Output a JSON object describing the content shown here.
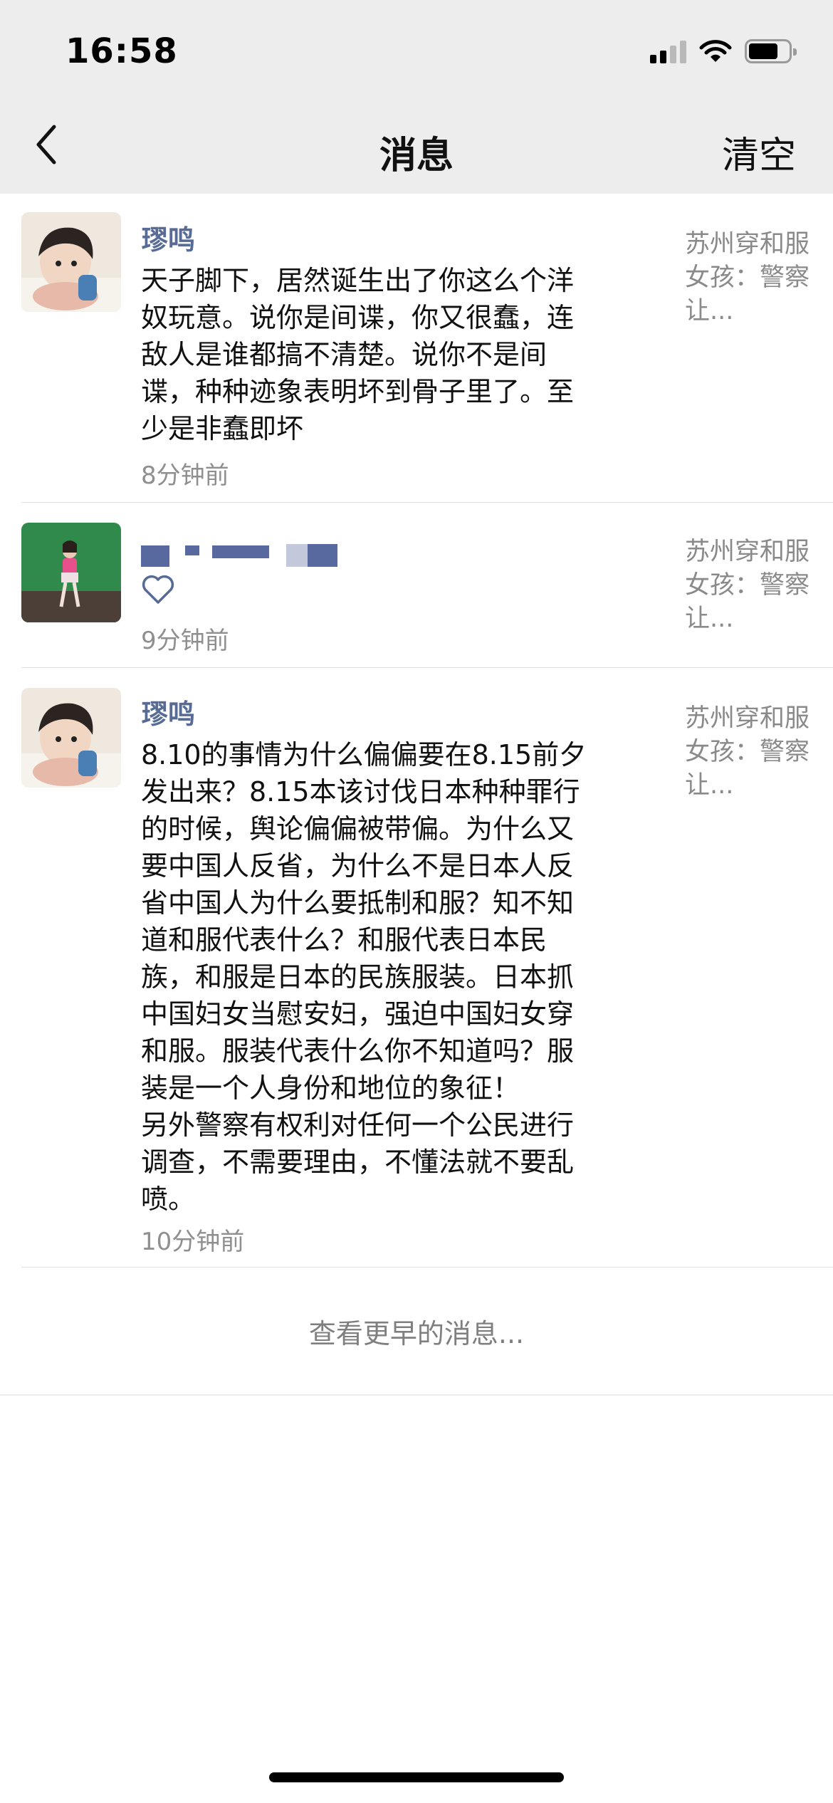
{
  "status_bar": {
    "time": "16:58"
  },
  "nav": {
    "title": "消息",
    "clear_label": "清空"
  },
  "messages": [
    {
      "name": "璆鸣",
      "content": "天子脚下，居然诞生出了你这么个洋\n奴玩意。说你是间谍，你又很蠢，连\n敌人是谁都搞不清楚。说你不是间\n谍，种种迹象表明坏到骨子里了。至\n少是非蠢即坏",
      "time": "8分钟前",
      "ref": "苏州穿和服女孩：警察让..."
    },
    {
      "name": "",
      "content": "",
      "time": "9分钟前",
      "ref": "苏州穿和服女孩：警察让..."
    },
    {
      "name": "璆鸣",
      "content": "8.10的事情为什么偏偏要在8.15前夕\n发出来？8.15本该讨伐日本种种罪行\n的时候，舆论偏偏被带偏。为什么又\n要中国人反省，为什么不是日本人反\n省中国人为什么要抵制和服？知不知\n道和服代表什么？和服代表日本民\n族，和服是日本的民族服装。日本抓\n中国妇女当慰安妇，强迫中国妇女穿\n和服。服装代表什么你不知道吗？服\n装是一个人身份和地位的象征！\n另外警察有权利对任何一个公民进行\n调查，不需要理由，不懂法就不要乱\n喷。",
      "time": "10分钟前",
      "ref": "苏州穿和服女孩：警察让..."
    }
  ],
  "more_label": "查看更早的消息...",
  "colors": {
    "nav_bg": "#ededed",
    "name_blue": "#576b95",
    "time_gray": "#8f8f8f"
  },
  "icons": {
    "back": "chevron-left-icon",
    "like": "heart-outline-icon"
  }
}
